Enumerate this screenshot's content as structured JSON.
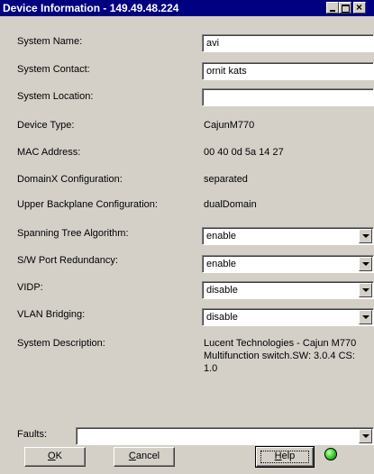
{
  "window": {
    "title": "Device Information - 149.49.48.224",
    "close_glyph": "×"
  },
  "fields": {
    "system_name": {
      "label": "System Name:",
      "value": "avi"
    },
    "system_contact": {
      "label": "System Contact:",
      "value": "ornit kats"
    },
    "system_location": {
      "label": "System Location:",
      "value": ""
    },
    "device_type": {
      "label": "Device Type:",
      "value": "CajunM770"
    },
    "mac_address": {
      "label": "MAC Address:",
      "value": "00 40 0d 5a 14 27"
    },
    "domainx_configuration": {
      "label": "DomainX Configuration:",
      "value": "separated"
    },
    "upper_backplane_configuration": {
      "label": "Upper Backplane Configuration:",
      "value": "dualDomain"
    },
    "spanning_tree_algorithm": {
      "label": "Spanning Tree Algorithm:",
      "value": "enable"
    },
    "sw_port_redundancy": {
      "label": "S/W Port Redundancy:",
      "value": "enable"
    },
    "vidp": {
      "label": "VIDP:",
      "value": "disable"
    },
    "vlan_bridging": {
      "label": "VLAN Bridging:",
      "value": "disable"
    },
    "system_description": {
      "label": "System Description:",
      "value": "Lucent Technologies - Cajun M770 Multifunction switch.SW: 3.0.4 CS: 1.0"
    },
    "faults": {
      "label": "Faults:",
      "value": ""
    }
  },
  "buttons": {
    "ok": {
      "mnemonic": "O",
      "rest": "K"
    },
    "cancel": {
      "mnemonic": "C",
      "rest": "ancel"
    },
    "help": {
      "mnemonic": "H",
      "rest": "elp"
    }
  },
  "status": {
    "led_color": "#22c41a"
  }
}
